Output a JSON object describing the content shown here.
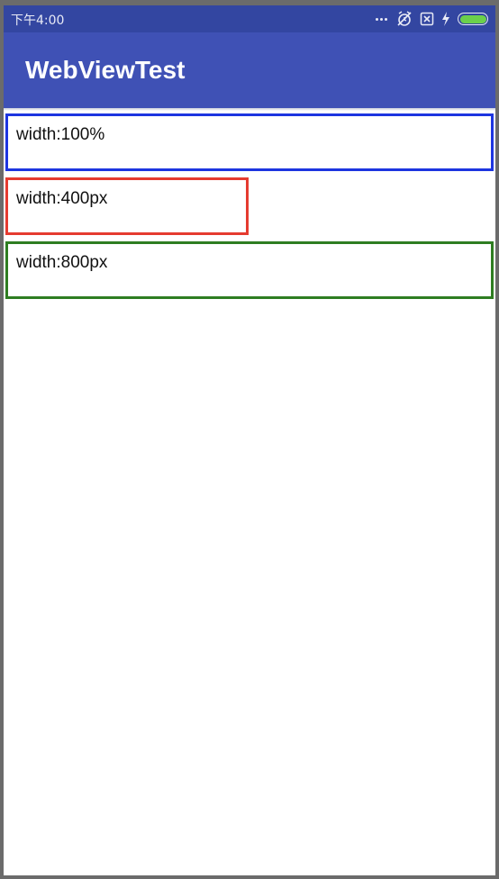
{
  "status_bar": {
    "time": "下午4:00",
    "icons": [
      "more-dots-icon",
      "alarm-off-icon",
      "sim-disabled-icon",
      "charging-bolt-icon",
      "battery-icon"
    ],
    "background_color": "#3346a1",
    "battery_level": 1.0,
    "battery_color": "#6bd04b"
  },
  "app_bar": {
    "title": "WebViewTest",
    "background_color": "#3f51b5"
  },
  "webview": {
    "boxes": [
      {
        "label": "width:100%",
        "border_color": "#1d35e0"
      },
      {
        "label": "width:400px",
        "border_color": "#e53b30"
      },
      {
        "label": "width:800px",
        "border_color": "#2e7d21"
      }
    ]
  }
}
